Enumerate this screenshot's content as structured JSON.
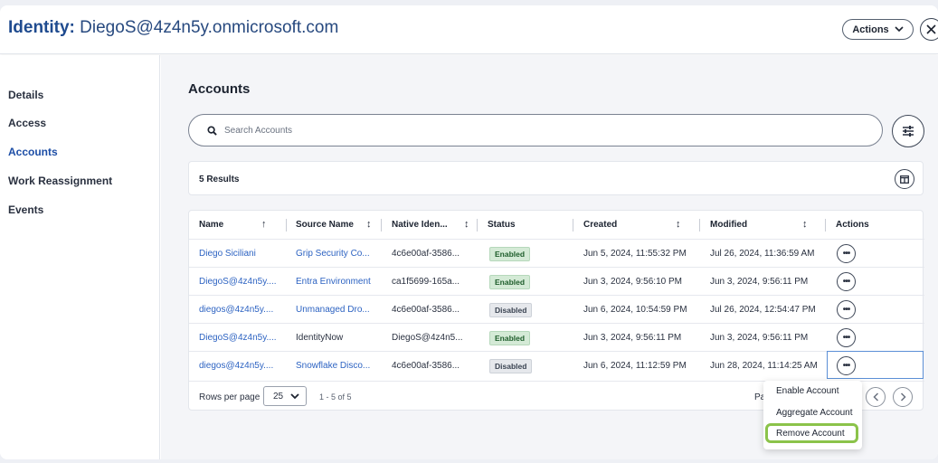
{
  "header": {
    "title_label": "Identity:",
    "title_value": "DiegoS@4z4n5y.onmicrosoft.com",
    "actions_label": "Actions"
  },
  "sidebar": {
    "items": [
      {
        "label": "Details"
      },
      {
        "label": "Access"
      },
      {
        "label": "Accounts"
      },
      {
        "label": "Work Reassignment"
      },
      {
        "label": "Events"
      }
    ],
    "active": "Accounts"
  },
  "main": {
    "heading": "Accounts",
    "search_placeholder": "Search Accounts",
    "results": "5 Results"
  },
  "table": {
    "columns": [
      "Name",
      "Source Name",
      "Native Iden...",
      "Status",
      "Created",
      "Modified",
      "Actions"
    ],
    "rows": [
      {
        "name": "Diego Siciliani",
        "source": "Grip Security Co...",
        "native": "4c6e00af-3586...",
        "status": "Enabled",
        "created": "Jun 5, 2024, 11:55:32 PM",
        "modified": "Jul 26, 2024, 11:36:59 AM",
        "source_link": true
      },
      {
        "name": "DiegoS@4z4n5y....",
        "source": "Entra Environment",
        "native": "ca1f5699-165a...",
        "status": "Enabled",
        "created": "Jun 3, 2024, 9:56:10 PM",
        "modified": "Jun 3, 2024, 9:56:11 PM",
        "source_link": true
      },
      {
        "name": "diegos@4z4n5y....",
        "source": "Unmanaged Dro...",
        "native": "4c6e00af-3586...",
        "status": "Disabled",
        "created": "Jun 6, 2024, 10:54:59 PM",
        "modified": "Jul 26, 2024, 12:54:47 PM",
        "source_link": true
      },
      {
        "name": "DiegoS@4z4n5y....",
        "source": "IdentityNow",
        "native": "DiegoS@4z4n5...",
        "status": "Enabled",
        "created": "Jun 3, 2024, 9:56:11 PM",
        "modified": "Jun 3, 2024, 9:56:11 PM",
        "source_link": false
      },
      {
        "name": "diegos@4z4n5y....",
        "source": "Snowflake Disco...",
        "native": "4c6e00af-3586...",
        "status": "Disabled",
        "created": "Jun 6, 2024, 11:12:59 PM",
        "modified": "Jun 28, 2024, 11:14:25 AM",
        "source_link": true
      }
    ],
    "more_label": "•••"
  },
  "pager": {
    "rows_label": "Rows per page",
    "rows_value": "25",
    "range": "1 - 5 of 5",
    "page_text": "Pa"
  },
  "menu": {
    "items": [
      "Enable Account",
      "Aggregate Account",
      "Remove Account"
    ],
    "highlighted": "Remove Account"
  },
  "colors": {
    "accent": "#1d4ea6",
    "link": "#2d63c2",
    "enabled_bg": "#d4ead6",
    "disabled_bg": "#e6e8ec",
    "highlight": "#8bc34a"
  }
}
